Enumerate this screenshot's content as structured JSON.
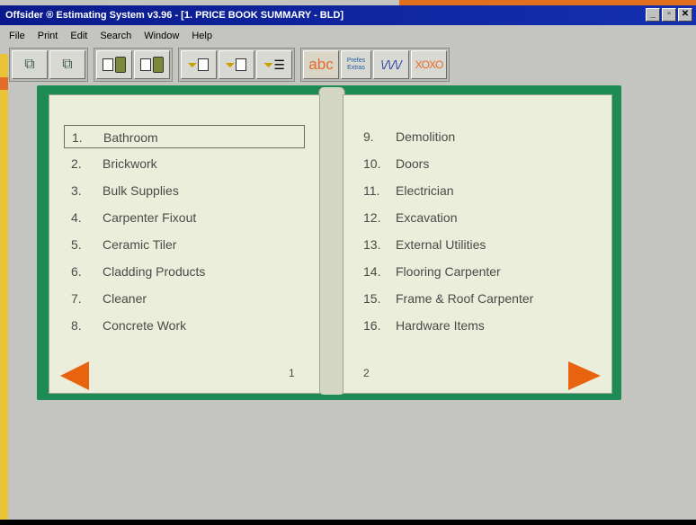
{
  "window": {
    "title": "Offsider ® Estimating System v3.96 - [1.  PRICE BOOK SUMMARY - BLD]",
    "controls": [
      "_",
      "▫",
      "✕"
    ]
  },
  "menu": [
    "File",
    "Print",
    "Edit",
    "Search",
    "Window",
    "Help"
  ],
  "toolbar": {
    "abc_label": "abc",
    "prefs_label": "Prefes Extras",
    "wave_label": "\\/\\/\\/",
    "xo_label": "XOXO"
  },
  "book": {
    "left_page": {
      "items": [
        {
          "num": "1.",
          "label": "Bathroom"
        },
        {
          "num": "2.",
          "label": "Brickwork"
        },
        {
          "num": "3.",
          "label": "Bulk Supplies"
        },
        {
          "num": "4.",
          "label": "Carpenter Fixout"
        },
        {
          "num": "5.",
          "label": "Ceramic Tiler"
        },
        {
          "num": "6.",
          "label": "Cladding Products"
        },
        {
          "num": "7.",
          "label": "Cleaner"
        },
        {
          "num": "8.",
          "label": "Concrete Work"
        }
      ],
      "page_number": "1"
    },
    "right_page": {
      "items": [
        {
          "num": "9.",
          "label": "Demolition"
        },
        {
          "num": "10.",
          "label": "Doors"
        },
        {
          "num": "11.",
          "label": "Electrician"
        },
        {
          "num": "12.",
          "label": "Excavation"
        },
        {
          "num": "13.",
          "label": "External Utilities"
        },
        {
          "num": "14.",
          "label": "Flooring Carpenter"
        },
        {
          "num": "15.",
          "label": "Frame & Roof Carpenter"
        },
        {
          "num": "16.",
          "label": "Hardware Items"
        }
      ],
      "page_number": "2"
    }
  },
  "colors": {
    "accent": "#e8630f",
    "book_green": "#1e8a55",
    "title_blue": "#0a1a8c"
  }
}
